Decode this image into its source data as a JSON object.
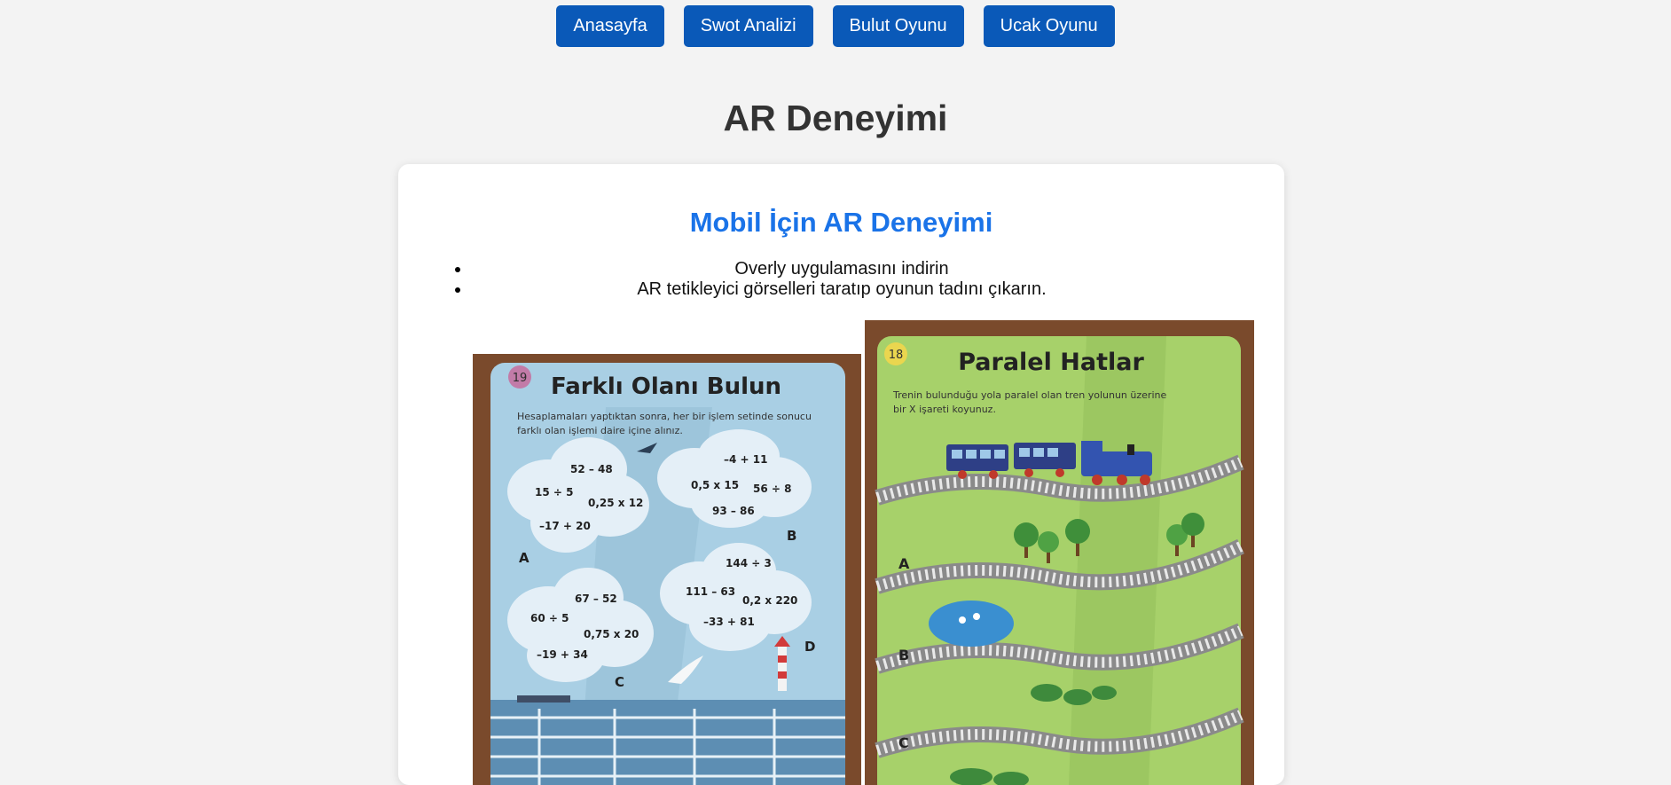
{
  "nav": {
    "items": [
      {
        "label": "Anasayfa"
      },
      {
        "label": "Swot Analizi"
      },
      {
        "label": "Bulut Oyunu"
      },
      {
        "label": "Ucak Oyunu"
      }
    ],
    "button_color": "#0a59b8"
  },
  "page": {
    "title": "AR Deneyimi"
  },
  "section": {
    "title": "Mobil İçin AR Deneyimi",
    "title_color": "#1a73e8",
    "instructions": [
      "Overly uygulamasını indirin",
      "AR tetikleyici görselleri taratıp oyunun tadını çıkarın."
    ]
  },
  "trigger_cards": {
    "card1": {
      "number": "19",
      "title": "Farklı Olanı Bulun",
      "description_line1": "Hesaplamaları yaptıktan sonra, her bir işlem setinde sonucu",
      "description_line2": "farklı olan işlemi daire içine alınız.",
      "clouds": {
        "A": {
          "label": "A",
          "ops": [
            "52 – 48",
            "15 ÷ 5",
            "0,25 x 12",
            "–17 + 20"
          ]
        },
        "B": {
          "label": "B",
          "ops": [
            "–4 + 11",
            "0,5 x 15",
            "56 ÷ 8",
            "93 – 86"
          ]
        },
        "C": {
          "label": "C",
          "ops": [
            "67 – 52",
            "60 ÷ 5",
            "0,75 x 20",
            "–19 + 34"
          ]
        },
        "D": {
          "label": "D",
          "ops": [
            "144 ÷ 3",
            "111 – 63",
            "0,2 x 220",
            "–33 + 81"
          ]
        }
      }
    },
    "card2": {
      "number": "18",
      "title": "Paralel Hatlar",
      "description_line1": "Trenin bulunduğu yola paralel olan tren yolunun üzerine",
      "description_line2": "bir X işareti koyunuz.",
      "track_labels": [
        "A",
        "B",
        "C"
      ]
    }
  }
}
